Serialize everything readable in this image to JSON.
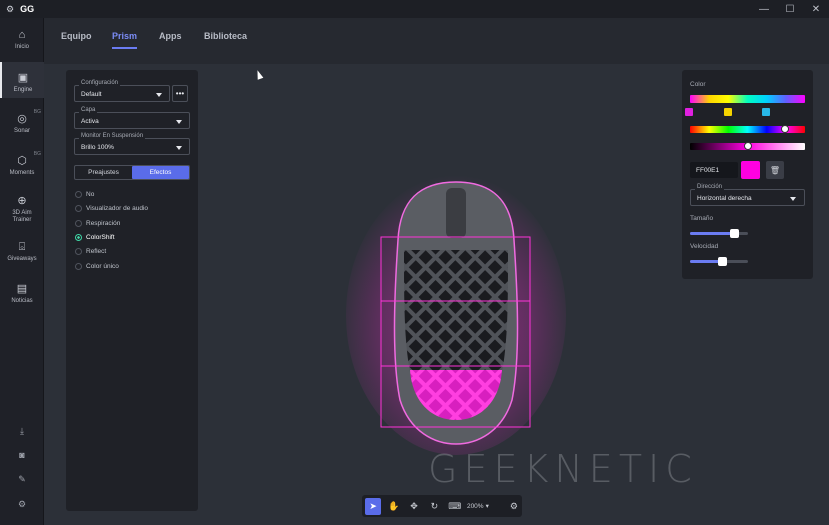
{
  "titlebar": {
    "app_name": "GG",
    "min": "—",
    "max": "☐",
    "close": "✕"
  },
  "sidebar": {
    "items": [
      {
        "label": "Inicio",
        "icon": "home-icon",
        "glyph": "⌂"
      },
      {
        "label": "Engine",
        "icon": "chip-icon",
        "glyph": "▣"
      },
      {
        "label": "Sonar",
        "icon": "sonar-icon",
        "glyph": "◎",
        "badge": "BG"
      },
      {
        "label": "Moments",
        "icon": "moments-icon",
        "glyph": "⬡",
        "badge": "BG"
      },
      {
        "label": "3D Aim Trainer",
        "icon": "aim-icon",
        "glyph": "⊕"
      },
      {
        "label": "Giveaways",
        "icon": "gift-icon",
        "glyph": "⌺"
      },
      {
        "label": "Noticias",
        "icon": "news-icon",
        "glyph": "▤"
      }
    ],
    "bottom": [
      {
        "icon": "download-icon",
        "glyph": "⤓"
      },
      {
        "icon": "discord-icon",
        "glyph": "◙"
      },
      {
        "icon": "feedback-icon",
        "glyph": "✎"
      },
      {
        "icon": "settings-icon",
        "glyph": "⚙"
      }
    ]
  },
  "tabs": [
    {
      "label": "Equipo",
      "active": false
    },
    {
      "label": "Prism",
      "active": true
    },
    {
      "label": "Apps",
      "active": false
    },
    {
      "label": "Biblioteca",
      "active": false
    }
  ],
  "left_panel": {
    "config": {
      "label": "Configuración",
      "value": "Default"
    },
    "more_button": "•••",
    "capa": {
      "label": "Capa",
      "value": "Activa"
    },
    "monitor": {
      "label": "Monitor En Suspensión",
      "value": "Brillo 100%"
    },
    "segment": {
      "left": "Preajustes",
      "right": "Efectos",
      "active": "right"
    },
    "effects": [
      {
        "label": "No",
        "selected": false
      },
      {
        "label": "Visualizador de audio",
        "selected": false
      },
      {
        "label": "Respiración",
        "selected": false
      },
      {
        "label": "ColorShift",
        "selected": true
      },
      {
        "label": "Reflect",
        "selected": false
      },
      {
        "label": "Color único",
        "selected": false
      }
    ]
  },
  "right_panel": {
    "color_label": "Color",
    "stops": [
      "#e020e0",
      "#f5d400",
      "#28b8e8"
    ],
    "hex": "FF00E1",
    "accent": "#ff00e1",
    "direction": {
      "label": "Dirección",
      "value": "Horizontal derecha"
    },
    "size_label": "Tamaño",
    "size_value": 0.75,
    "speed_label": "Velocidad",
    "speed_value": 0.55,
    "trash_icon": "🗑"
  },
  "toolbar": {
    "tools": [
      {
        "icon": "pointer-icon",
        "glyph": "➤",
        "active": true
      },
      {
        "icon": "hand-icon",
        "glyph": "✋",
        "active": false
      },
      {
        "icon": "move-icon",
        "glyph": "✥",
        "active": false
      },
      {
        "icon": "rotate-icon",
        "glyph": "↻",
        "active": false
      },
      {
        "icon": "keyboard-icon",
        "glyph": "⌨",
        "active": false
      }
    ],
    "zoom": "200%",
    "settings_glyph": "⚙"
  },
  "watermark": "GEEKNETIC"
}
